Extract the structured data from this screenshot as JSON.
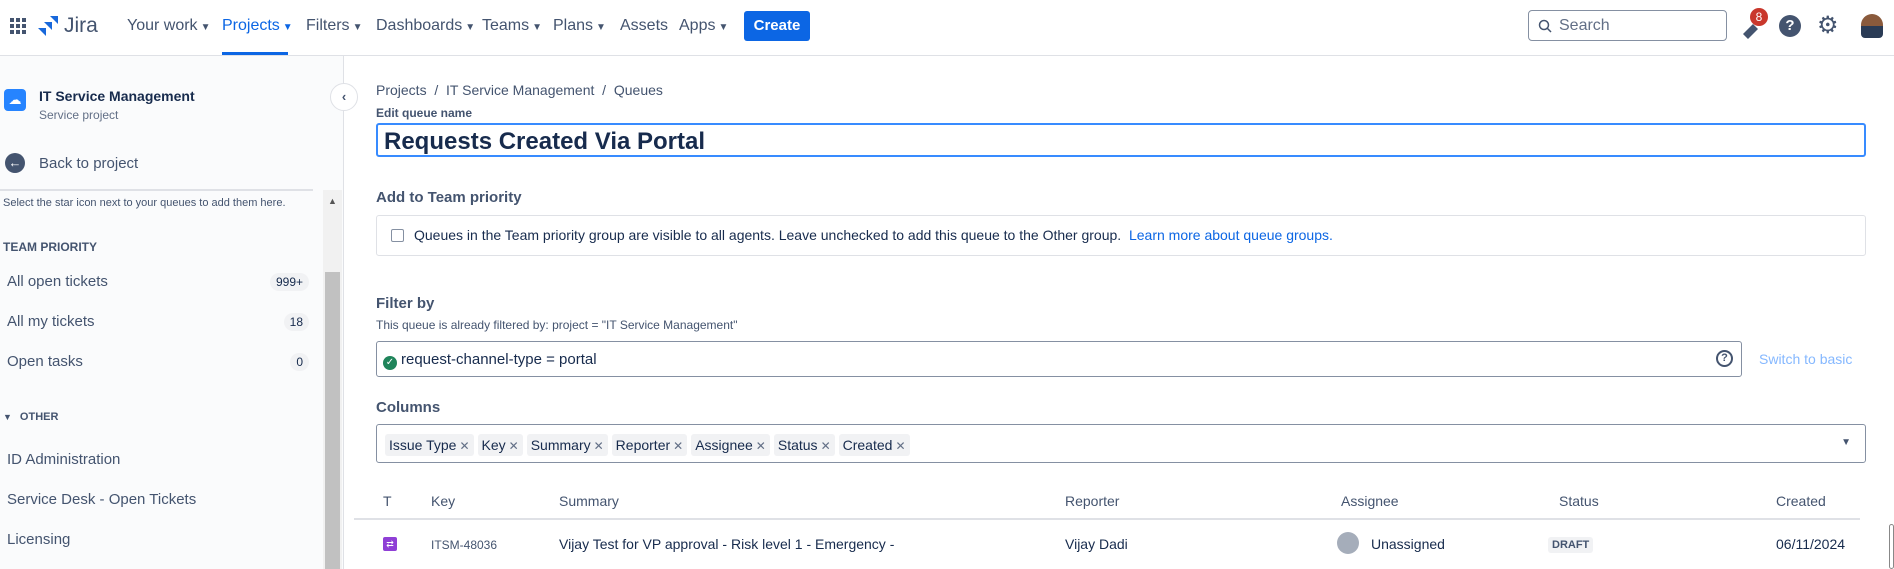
{
  "nav": {
    "app_name": "Jira",
    "items": [
      "Your work",
      "Projects",
      "Filters",
      "Dashboards",
      "Teams",
      "Plans",
      "Assets",
      "Apps"
    ],
    "create": "Create",
    "search_placeholder": "Search",
    "notifications": "8"
  },
  "sidebar": {
    "project_name": "IT Service Management",
    "project_type": "Service project",
    "back": "Back to project",
    "hint": "Select the star icon next to your queues to add them here.",
    "team_priority": "TEAM PRIORITY",
    "team_items": [
      {
        "label": "All open tickets",
        "count": "999+"
      },
      {
        "label": "All my tickets",
        "count": "18"
      },
      {
        "label": "Open tasks",
        "count": "0"
      }
    ],
    "other": "OTHER",
    "other_items": [
      "ID Administration",
      "Service Desk - Open Tickets",
      "Licensing"
    ]
  },
  "main": {
    "breadcrumb": [
      "Projects",
      "IT Service Management",
      "Queues"
    ],
    "edit_label": "Edit queue name",
    "queue_name": "Requests Created Via Portal",
    "team_priority_label": "Add to Team priority",
    "team_priority_text": "Queues in the Team priority group are visible to all agents. Leave unchecked to add this queue to the Other group.",
    "learn_more": "Learn more about queue groups.",
    "filter_label": "Filter by",
    "already_filtered": "This queue is already filtered by:  project = \"IT Service Management\"",
    "jql": "request-channel-type = portal",
    "switch_basic": "Switch to basic",
    "columns_label": "Columns",
    "columns": [
      "Issue Type",
      "Key",
      "Summary",
      "Reporter",
      "Assignee",
      "Status",
      "Created"
    ]
  },
  "table": {
    "headers": [
      "T",
      "Key",
      "Summary",
      "Reporter",
      "Assignee",
      "Status",
      "Created"
    ],
    "rows": [
      {
        "key": "ITSM-48036",
        "summary": "Vijay Test for VP approval - Risk level 1 - Emergency -",
        "reporter": "Vijay Dadi",
        "assignee": "Unassigned",
        "status": "DRAFT",
        "created": "06/11/2024"
      }
    ]
  }
}
